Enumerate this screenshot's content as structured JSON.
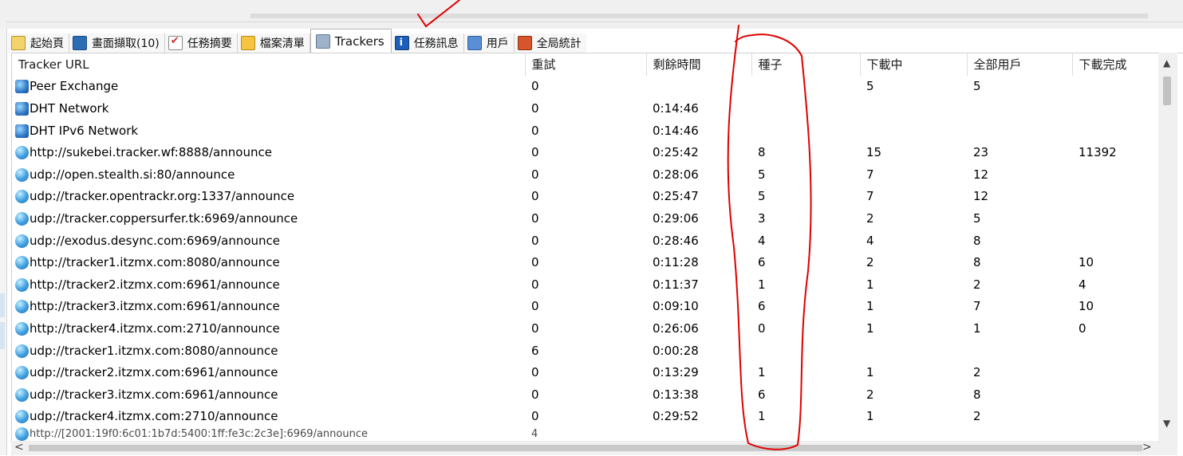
{
  "tabs": [
    {
      "label": "起始頁",
      "icon": "home-icon"
    },
    {
      "label": "畫面擷取(10)",
      "icon": "screenshot-icon"
    },
    {
      "label": "任務摘要",
      "icon": "checklist-icon"
    },
    {
      "label": "檔案清單",
      "icon": "files-icon"
    },
    {
      "label": "Trackers",
      "icon": "trackers-icon",
      "active": true
    },
    {
      "label": "任務訊息",
      "icon": "info-icon"
    },
    {
      "label": "用戶",
      "icon": "peers-icon"
    },
    {
      "label": "全局統計",
      "icon": "stats-icon"
    }
  ],
  "columns": [
    "Tracker URL",
    "重試",
    "剩餘時間",
    "種子",
    "下載中",
    "全部用戶",
    "下載完成"
  ],
  "rows": [
    {
      "icon": "network-icon",
      "url": "Peer Exchange",
      "retry": "0",
      "time": "",
      "seeds": "",
      "downloading": "5",
      "peers": "5",
      "completed": ""
    },
    {
      "icon": "network-icon",
      "url": "DHT Network",
      "retry": "0",
      "time": "0:14:46",
      "seeds": "",
      "downloading": "",
      "peers": "",
      "completed": ""
    },
    {
      "icon": "network-icon",
      "url": "DHT IPv6 Network",
      "retry": "0",
      "time": "0:14:46",
      "seeds": "",
      "downloading": "",
      "peers": "",
      "completed": ""
    },
    {
      "icon": "globe-icon",
      "url": "http://sukebei.tracker.wf:8888/announce",
      "retry": "0",
      "time": "0:25:42",
      "seeds": "8",
      "downloading": "15",
      "peers": "23",
      "completed": "11392"
    },
    {
      "icon": "globe-icon",
      "url": "udp://open.stealth.si:80/announce",
      "retry": "0",
      "time": "0:28:06",
      "seeds": "5",
      "downloading": "7",
      "peers": "12",
      "completed": ""
    },
    {
      "icon": "globe-icon",
      "url": "udp://tracker.opentrackr.org:1337/announce",
      "retry": "0",
      "time": "0:25:47",
      "seeds": "5",
      "downloading": "7",
      "peers": "12",
      "completed": ""
    },
    {
      "icon": "globe-icon",
      "url": "udp://tracker.coppersurfer.tk:6969/announce",
      "retry": "0",
      "time": "0:29:06",
      "seeds": "3",
      "downloading": "2",
      "peers": "5",
      "completed": ""
    },
    {
      "icon": "globe-icon",
      "url": "udp://exodus.desync.com:6969/announce",
      "retry": "0",
      "time": "0:28:46",
      "seeds": "4",
      "downloading": "4",
      "peers": "8",
      "completed": ""
    },
    {
      "icon": "globe-icon",
      "url": "http://tracker1.itzmx.com:8080/announce",
      "retry": "0",
      "time": "0:11:28",
      "seeds": "6",
      "downloading": "2",
      "peers": "8",
      "completed": "10"
    },
    {
      "icon": "globe-icon",
      "url": "http://tracker2.itzmx.com:6961/announce",
      "retry": "0",
      "time": "0:11:37",
      "seeds": "1",
      "downloading": "1",
      "peers": "2",
      "completed": "4"
    },
    {
      "icon": "globe-icon",
      "url": "http://tracker3.itzmx.com:6961/announce",
      "retry": "0",
      "time": "0:09:10",
      "seeds": "6",
      "downloading": "1",
      "peers": "7",
      "completed": "10"
    },
    {
      "icon": "globe-icon",
      "url": "http://tracker4.itzmx.com:2710/announce",
      "retry": "0",
      "time": "0:26:06",
      "seeds": "0",
      "downloading": "1",
      "peers": "1",
      "completed": "0"
    },
    {
      "icon": "globe-icon",
      "url": "udp://tracker1.itzmx.com:8080/announce",
      "retry": "6",
      "time": "0:00:28",
      "seeds": "",
      "downloading": "",
      "peers": "",
      "completed": ""
    },
    {
      "icon": "globe-icon",
      "url": "udp://tracker2.itzmx.com:6961/announce",
      "retry": "0",
      "time": "0:13:29",
      "seeds": "1",
      "downloading": "1",
      "peers": "2",
      "completed": ""
    },
    {
      "icon": "globe-icon",
      "url": "udp://tracker3.itzmx.com:6961/announce",
      "retry": "0",
      "time": "0:13:38",
      "seeds": "6",
      "downloading": "2",
      "peers": "8",
      "completed": ""
    },
    {
      "icon": "globe-icon",
      "url": "udp://tracker4.itzmx.com:2710/announce",
      "retry": "0",
      "time": "0:29:52",
      "seeds": "1",
      "downloading": "1",
      "peers": "2",
      "completed": ""
    },
    {
      "icon": "globe-icon",
      "url": "http://[2001:19f0:6c01:1b7d:5400:1ff:fe3c:2c3e]:6969/announce",
      "retry": "4",
      "time": "",
      "seeds": "",
      "downloading": "",
      "peers": "",
      "completed": ""
    }
  ],
  "annotation_color": "#e00000"
}
